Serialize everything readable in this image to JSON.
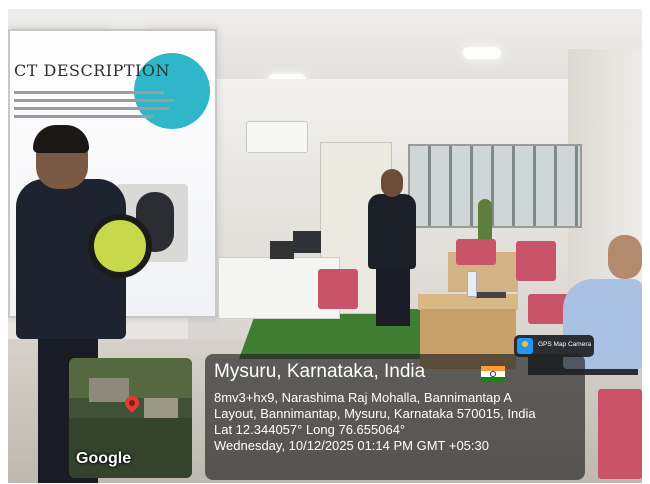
{
  "slide": {
    "title": "CT DESCRIPTION"
  },
  "gps_overlay": {
    "app_name": "GPS Map Camera",
    "map_label": "Google",
    "location_title": "Mysuru, Karnataka, India",
    "address_line_1": "8mv3+hx9, Narashima Raj Mohalla, Bannimantap A",
    "address_line_2": "Layout, Bannimantap, Mysuru, Karnataka 570015, India",
    "coordinates": "Lat 12.344057° Long 76.655064°",
    "datetime": "Wednesday, 10/12/2025 01:14 PM GMT +05:30",
    "flag_colors": [
      "#ff9933",
      "#ffffff",
      "#138808"
    ]
  },
  "scene_icons": [
    "map-pin-icon",
    "india-flag-icon",
    "camera-app-icon"
  ]
}
